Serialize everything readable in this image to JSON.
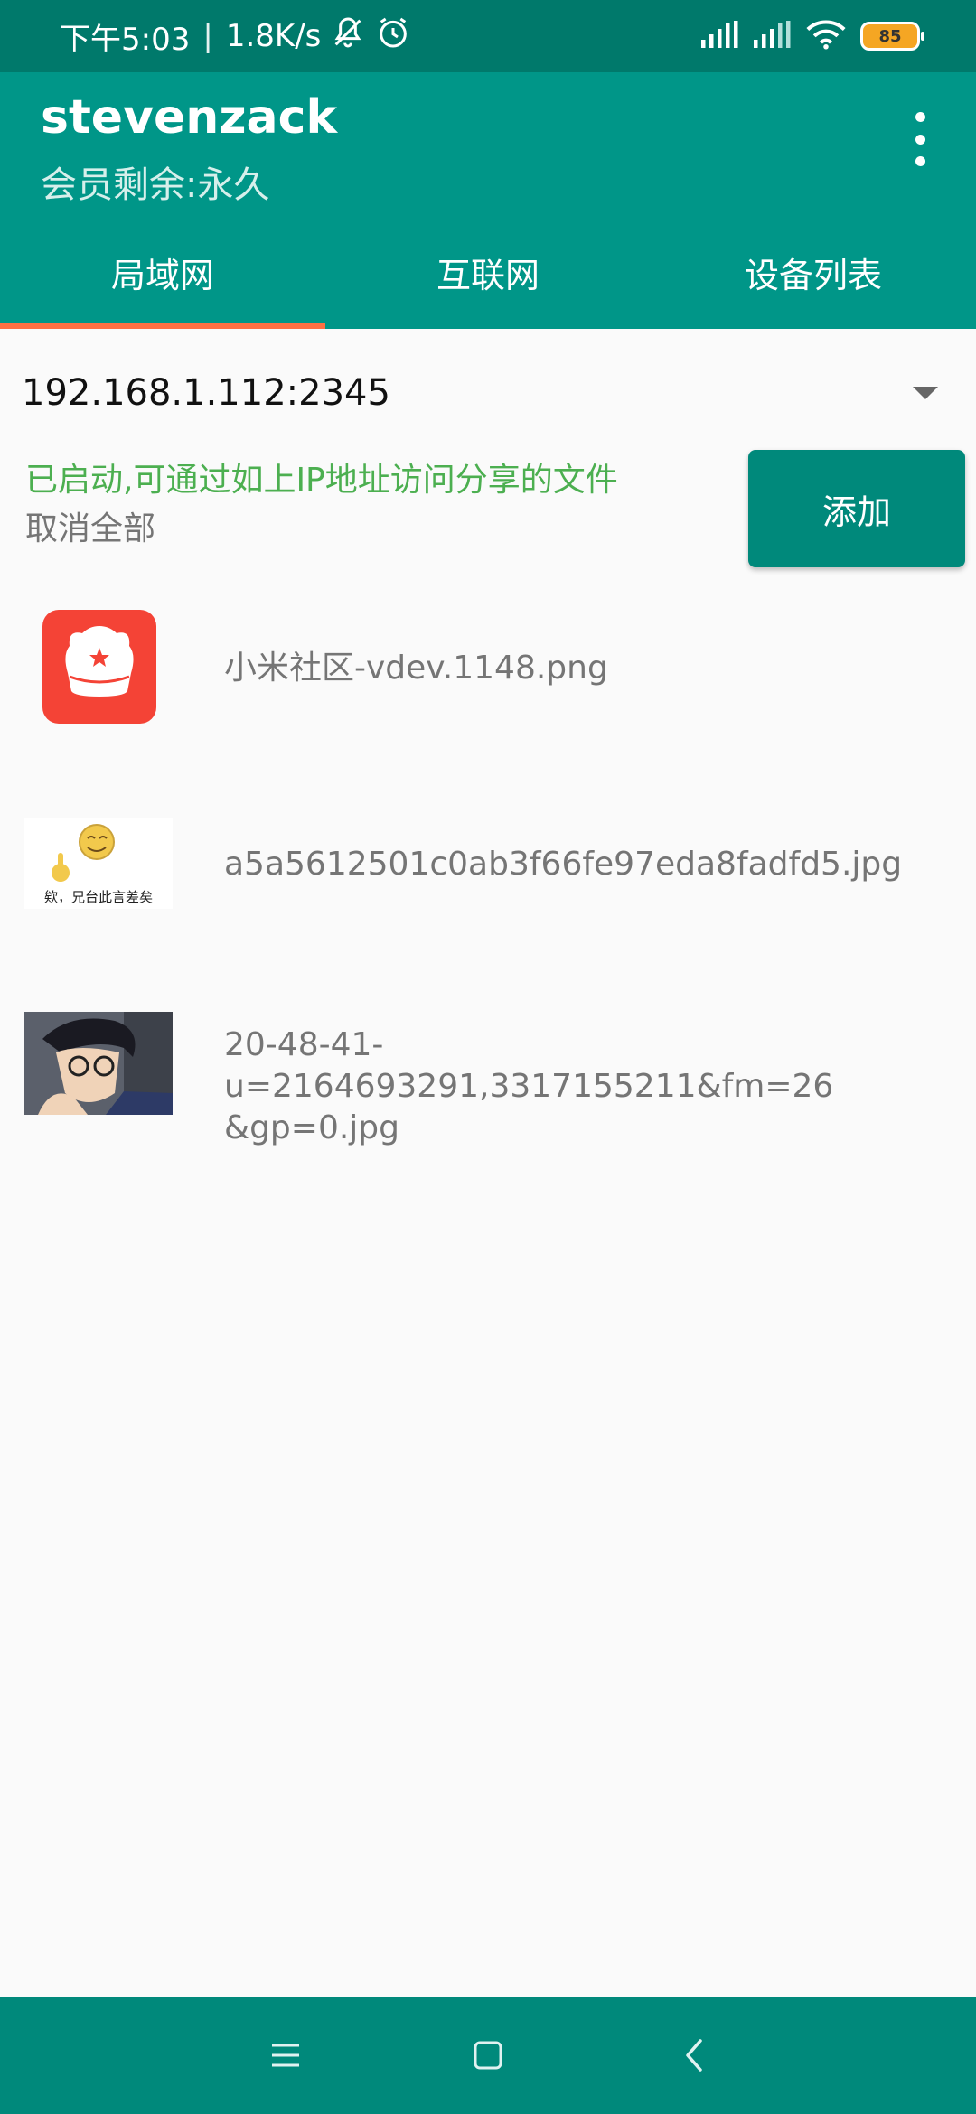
{
  "status_bar": {
    "time": "下午5:03",
    "separator": "|",
    "speed": "1.8K/s",
    "battery": "85"
  },
  "app_bar": {
    "title": "stevenzack",
    "subtitle": "会员剩余:永久",
    "tabs": [
      {
        "label": "局域网",
        "active": true
      },
      {
        "label": "互联网",
        "active": false
      },
      {
        "label": "设备列表",
        "active": false
      }
    ]
  },
  "server": {
    "address": "192.168.1.112:2345",
    "status": "已启动,可通过如上IP地址访问分享的文件",
    "cancel_all": "取消全部",
    "add_button": "添加"
  },
  "files": [
    {
      "name": "小米社区-vdev.1148.png"
    },
    {
      "name": "a5a5612501c0ab3f66fe97eda8fadfd5.jpg",
      "caption": "欸，兄台此言差矣"
    },
    {
      "name_line1": "20-48-41-u=2164693291,3317155211&fm=26",
      "name_line2": "&gp=0.jpg"
    }
  ],
  "colors": {
    "primary": "#009688",
    "primary_dark": "#00796b",
    "accent": "#ff7043",
    "status_green": "#4caf50"
  }
}
